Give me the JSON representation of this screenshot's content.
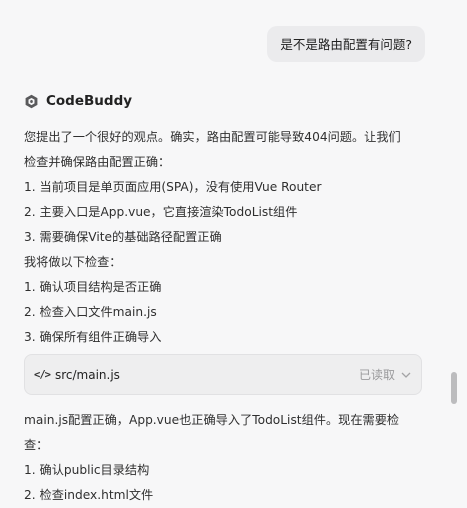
{
  "user_message": "是不是路由配置有问题?",
  "assistant": {
    "name": "CodeBuddy",
    "intro_line1": "您提出了一个很好的观点。确实，路由配置可能导致404问题。让我们",
    "intro_line2": "检查并确保路由配置正确：",
    "findings": [
      "1. 当前项目是单页面应用(SPA)，没有使用Vue Router",
      "2. 主要入口是App.vue，它直接渲染TodoList组件",
      "3. 需要确保Vite的基础路径配置正确"
    ],
    "plan_title": "我将做以下检查：",
    "plan": [
      "1. 确认项目结构是否正确",
      "2. 检查入口文件main.js",
      "3. 确保所有组件正确导入"
    ],
    "file_card": {
      "icon": "code-icon",
      "icon_glyph": "</>",
      "filename": "src/main.js",
      "status": "已读取"
    },
    "followup_line1": "main.js配置正确，App.vue也正确导入了TodoList组件。现在需要检",
    "followup_line2": "查：",
    "next_steps": [
      "1. 确认public目录结构",
      "2. 检查index.html文件"
    ]
  },
  "colors": {
    "brand_logo": "#555555",
    "background": "#f7f7f8",
    "bubble": "#ebebed"
  }
}
